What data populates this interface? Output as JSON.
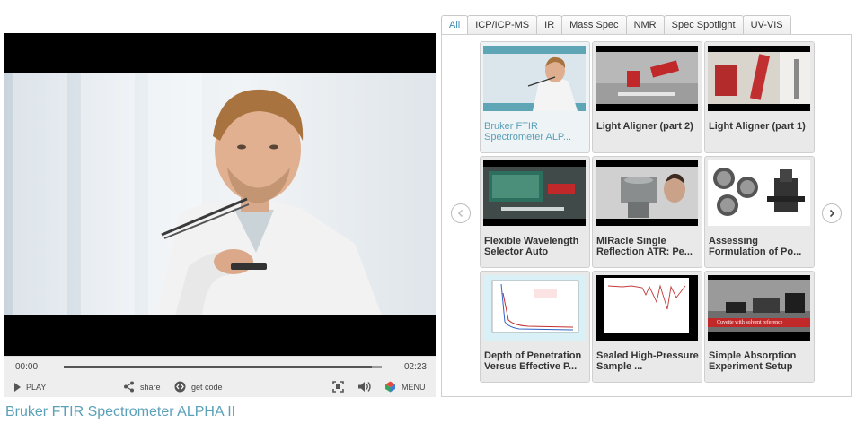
{
  "player": {
    "time_elapsed": "00:00",
    "time_total": "02:23",
    "progress": 0.97,
    "play_label": "PLAY",
    "share_label": "share",
    "code_label": "get code",
    "menu_label": "MENU"
  },
  "video_title": "Bruker FTIR Spectrometer ALPHA II",
  "tabs": [
    {
      "label": "All",
      "active": true
    },
    {
      "label": "ICP/ICP-MS"
    },
    {
      "label": "IR"
    },
    {
      "label": "Mass Spec"
    },
    {
      "label": "NMR"
    },
    {
      "label": "Spec Spotlight"
    },
    {
      "label": "UV-VIS"
    }
  ],
  "gallery": {
    "items": [
      {
        "title": "Bruker FTIR Spectrometer ALP...",
        "selected": true
      },
      {
        "title": "Light Aligner (part 2)"
      },
      {
        "title": "Light Aligner (part 1)"
      },
      {
        "title": "Flexible Wavelength Selector Auto"
      },
      {
        "title": "MIRacle Single Reflection ATR: Pe..."
      },
      {
        "title": "Assessing Formulation of Po..."
      },
      {
        "title": "Depth of Penetration Versus Effective P..."
      },
      {
        "title": "Sealed High-Pressure Sample ..."
      },
      {
        "title": "Simple Absorption Experiment Setup"
      }
    ],
    "thumb_caption_9": "Cuvette with solvent reference"
  },
  "icons": {
    "prev": "chevron-left-icon",
    "next": "chevron-right-icon",
    "play": "play-icon",
    "share": "share-icon",
    "code": "code-icon",
    "fullscreen": "fullscreen-icon",
    "volume": "volume-icon",
    "menu": "menu-icon"
  },
  "colors": {
    "accent": "#5aa0b8",
    "tab_active": "#3b8ab0"
  }
}
